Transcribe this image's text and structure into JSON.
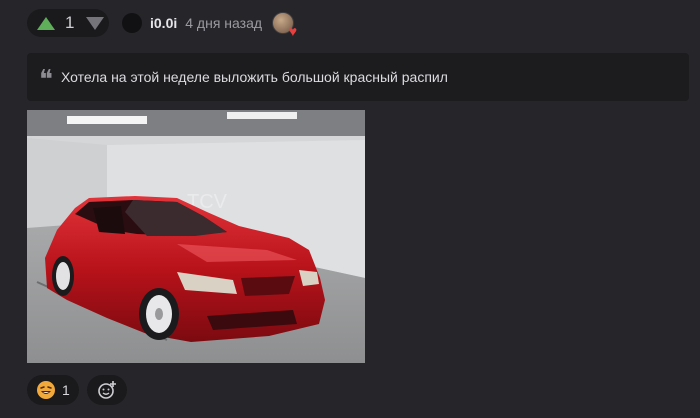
{
  "vote": {
    "score": "1",
    "up_icon": "arrow-up-icon",
    "down_icon": "arrow-down-icon",
    "up_color": "#5fae5a",
    "down_color": "#74747a"
  },
  "author": {
    "username": "i0.0i",
    "time": "4 дня назад",
    "badge_icon": "heart-badge-icon"
  },
  "quote": {
    "icon": "quote-icon",
    "text": "Хотела на этой неделе выложить большой красный распил"
  },
  "photo": {
    "subject": "red-sedan-photo",
    "watermark": "TCV"
  },
  "reactions": {
    "items": [
      {
        "icon": "laughing-emoji-icon",
        "count": "1"
      }
    ],
    "add_icon": "add-reaction-icon"
  },
  "colors": {
    "background": "#26262a",
    "panel": "#1a1a1d",
    "car_red": "#c0141a"
  }
}
